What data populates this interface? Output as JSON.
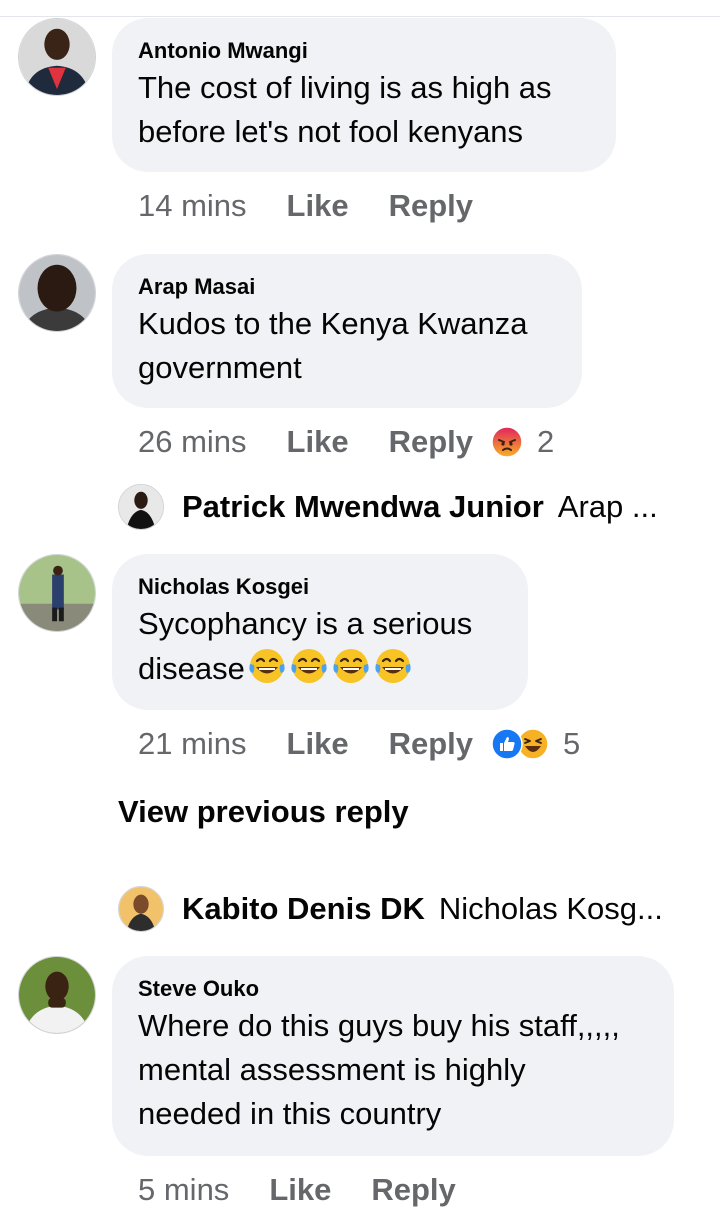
{
  "comments": [
    {
      "author": "Antonio Mwangi",
      "text": "The cost of living is as high as\nbefore let's not fool kenyans",
      "time": "14 mins",
      "like_label": "Like",
      "reply_label": "Reply"
    },
    {
      "author": "Arap Masai",
      "text": "Kudos to the Kenya Kwanza\ngovernment",
      "time": "26 mins",
      "like_label": "Like",
      "reply_label": "Reply",
      "reaction_icons": [
        "angry-reaction-icon"
      ],
      "reaction_count": "2",
      "reply_preview": {
        "name": "Patrick Mwendwa Junior",
        "text": "Arap ..."
      }
    },
    {
      "author": "Nicholas Kosgei",
      "text": "Sycophancy is a serious\ndisease",
      "emoji": [
        "laughing-tears-icon",
        "laughing-tears-icon",
        "laughing-tears-icon",
        "laughing-tears-icon"
      ],
      "time": "21 mins",
      "like_label": "Like",
      "reply_label": "Reply",
      "reaction_icons": [
        "like-reaction-icon",
        "haha-reaction-icon"
      ],
      "reaction_count": "5",
      "view_previous_label": "View previous reply",
      "reply_preview": {
        "name": "Kabito Denis DK",
        "text": "Nicholas Kosg..."
      }
    },
    {
      "author": "Steve Ouko",
      "text": "Where do this guys buy his staff,,,,,\nmental assessment is highly\nneeded in this country",
      "time": "5 mins",
      "like_label": "Like",
      "reply_label": "Reply"
    }
  ],
  "colors": {
    "bubble_bg": "#f0f2f5",
    "meta_text": "#65676b",
    "like_blue": "#1877f2",
    "angry_orange": "#e9710f",
    "haha_yellow": "#f7b125"
  }
}
